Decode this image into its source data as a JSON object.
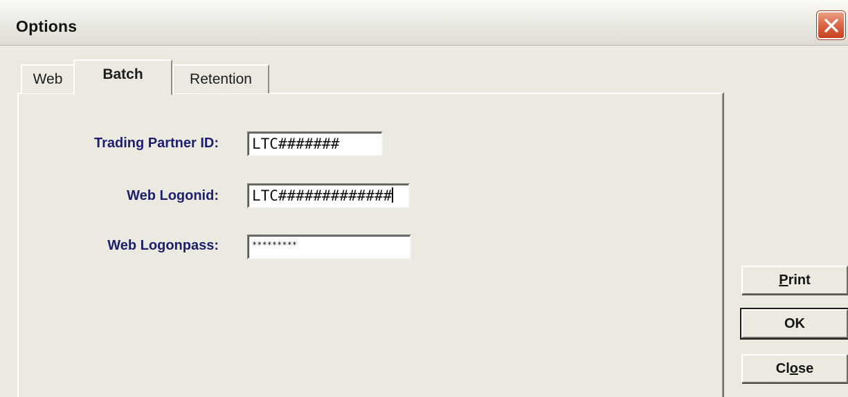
{
  "window": {
    "title": "Options",
    "close_icon": "close-icon"
  },
  "tabs": [
    {
      "label": "Web",
      "selected": false
    },
    {
      "label": "Batch",
      "selected": true
    },
    {
      "label": "Retention",
      "selected": false
    }
  ],
  "form": {
    "trading_partner_id": {
      "label": "Trading Partner ID:",
      "value": "LTC#######"
    },
    "web_logonid": {
      "label": "Web Logonid:",
      "value": "LTC#############"
    },
    "web_logonpass": {
      "label": "Web Logonpass:",
      "value": "*********"
    }
  },
  "buttons": {
    "print": {
      "label": "Print",
      "mnemonic": "P"
    },
    "ok": {
      "label": "OK"
    },
    "close": {
      "label": "Close",
      "mnemonic": "o"
    }
  },
  "colors": {
    "label_text": "#1a1f6e",
    "close_button": "#dc6a4a",
    "dialog_bg": "#eceae0"
  }
}
